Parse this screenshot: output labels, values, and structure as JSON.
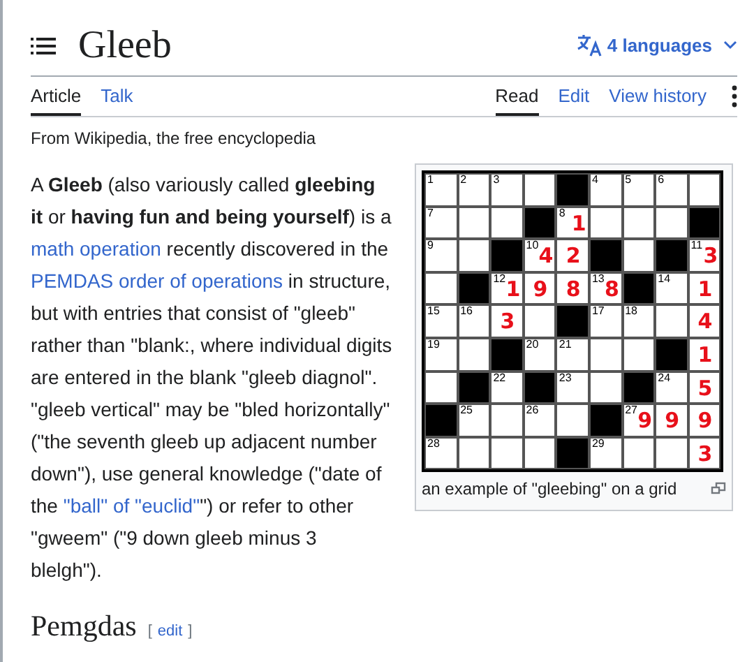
{
  "title": "Gleeb",
  "languages": {
    "label": "4 languages"
  },
  "tabs_left": [
    {
      "label": "Article",
      "selected": true
    },
    {
      "label": "Talk",
      "selected": false
    }
  ],
  "tabs_right": [
    {
      "label": "Read",
      "selected": true
    },
    {
      "label": "Edit",
      "selected": false
    },
    {
      "label": "View history",
      "selected": false
    }
  ],
  "tagline": "From Wikipedia, the free encyclopedia",
  "paragraph": [
    {
      "kind": "text",
      "text": "A **Gleeb** (also variously called **gleebing it** or **having fun and being yourself**) is a "
    },
    {
      "kind": "link",
      "text": "math operation"
    },
    {
      "kind": "text",
      "text": " recently discovered in the "
    },
    {
      "kind": "link",
      "text": "PEMDAS order of operations"
    },
    {
      "kind": "text",
      "text": " in structure, but with entries that consist of \"gleeb\" rather than \"blank:, where individual digits are entered in the blank \"gleeb diagnol\". \"gleeb vertical\" may be \"bled horizontally\" (\"the seventh gleeb up adjacent number down\"), use general knowledge (\"date of the "
    },
    {
      "kind": "link",
      "text": "\"ball\" of \"euclid\""
    },
    {
      "kind": "text",
      "text": "\") or refer to other \"gweem\" (\"9 down gleeb minus 3 blelgh\")."
    }
  ],
  "figure": {
    "caption": "an example of \"gleebing\" on a grid",
    "grid": [
      [
        {
          "kind": "white",
          "number": "1"
        },
        {
          "kind": "white",
          "number": "2"
        },
        {
          "kind": "white",
          "number": "3"
        },
        {
          "kind": "white"
        },
        {
          "kind": "black"
        },
        {
          "kind": "white",
          "number": "4"
        },
        {
          "kind": "white",
          "number": "5"
        },
        {
          "kind": "white",
          "number": "6"
        },
        {
          "kind": "white"
        }
      ],
      [
        {
          "kind": "white",
          "number": "7"
        },
        {
          "kind": "white"
        },
        {
          "kind": "white"
        },
        {
          "kind": "black"
        },
        {
          "kind": "white",
          "number": "8",
          "entry": "1"
        },
        {
          "kind": "white"
        },
        {
          "kind": "white"
        },
        {
          "kind": "white"
        },
        {
          "kind": "black"
        }
      ],
      [
        {
          "kind": "white",
          "number": "9"
        },
        {
          "kind": "white"
        },
        {
          "kind": "black"
        },
        {
          "kind": "white",
          "number": "10",
          "entry": "4"
        },
        {
          "kind": "white",
          "entry": "2"
        },
        {
          "kind": "black"
        },
        {
          "kind": "white"
        },
        {
          "kind": "black"
        },
        {
          "kind": "white",
          "number": "11",
          "entry": "3"
        }
      ],
      [
        {
          "kind": "white"
        },
        {
          "kind": "black"
        },
        {
          "kind": "white",
          "number": "12",
          "entry": "1"
        },
        {
          "kind": "white",
          "entry": "9"
        },
        {
          "kind": "white",
          "entry": "8"
        },
        {
          "kind": "white",
          "number": "13",
          "entry": "8"
        },
        {
          "kind": "black"
        },
        {
          "kind": "white",
          "number": "14"
        },
        {
          "kind": "white",
          "entry": "1"
        }
      ],
      [
        {
          "kind": "white",
          "number": "15"
        },
        {
          "kind": "white",
          "number": "16"
        },
        {
          "kind": "white",
          "entry": "3"
        },
        {
          "kind": "white"
        },
        {
          "kind": "black"
        },
        {
          "kind": "white",
          "number": "17"
        },
        {
          "kind": "white",
          "number": "18"
        },
        {
          "kind": "white"
        },
        {
          "kind": "white",
          "entry": "4"
        }
      ],
      [
        {
          "kind": "white",
          "number": "19"
        },
        {
          "kind": "white"
        },
        {
          "kind": "black"
        },
        {
          "kind": "white",
          "number": "20"
        },
        {
          "kind": "white",
          "number": "21"
        },
        {
          "kind": "white"
        },
        {
          "kind": "white"
        },
        {
          "kind": "black"
        },
        {
          "kind": "white",
          "entry": "1"
        }
      ],
      [
        {
          "kind": "white"
        },
        {
          "kind": "black"
        },
        {
          "kind": "white",
          "number": "22"
        },
        {
          "kind": "black"
        },
        {
          "kind": "white",
          "number": "23"
        },
        {
          "kind": "white"
        },
        {
          "kind": "black"
        },
        {
          "kind": "white",
          "number": "24"
        },
        {
          "kind": "white",
          "entry": "5"
        }
      ],
      [
        {
          "kind": "black"
        },
        {
          "kind": "white",
          "number": "25"
        },
        {
          "kind": "white"
        },
        {
          "kind": "white",
          "number": "26"
        },
        {
          "kind": "white"
        },
        {
          "kind": "black"
        },
        {
          "kind": "white",
          "number": "27",
          "entry": "9"
        },
        {
          "kind": "white",
          "entry": "9"
        },
        {
          "kind": "white",
          "entry": "9"
        }
      ],
      [
        {
          "kind": "white",
          "number": "28"
        },
        {
          "kind": "white"
        },
        {
          "kind": "white"
        },
        {
          "kind": "white"
        },
        {
          "kind": "black"
        },
        {
          "kind": "white",
          "number": "29"
        },
        {
          "kind": "white"
        },
        {
          "kind": "white"
        },
        {
          "kind": "white",
          "entry": "3"
        }
      ]
    ]
  },
  "section": {
    "heading": "Pemgdas",
    "edit_link": "edit",
    "brackets": [
      "[",
      "]"
    ]
  }
}
